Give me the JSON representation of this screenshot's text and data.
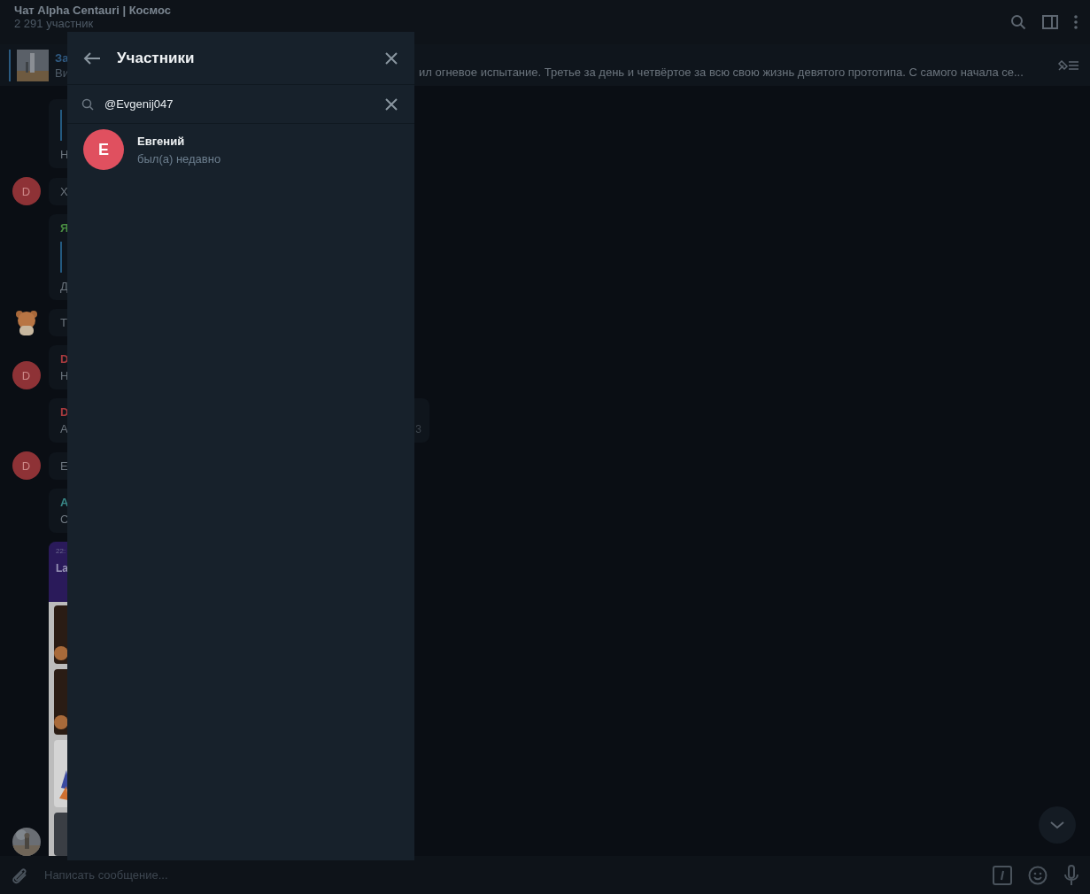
{
  "header": {
    "title": "Чат Alpha Centauri | Космос",
    "subtitle": "2 291 участник"
  },
  "pinned": {
    "title": "За",
    "sender": "Ви",
    "text": "ил огневое испытание. Третье за день и четвёртое за всю свою жизнь девятого прототипа. С самого начала се..."
  },
  "messages": [
    {
      "kind": "text",
      "quote": true,
      "text": "Н"
    },
    {
      "kind": "text",
      "quote": false,
      "text": "Х",
      "avatar": {
        "kind": "letter",
        "letter": "D"
      }
    },
    {
      "kind": "text",
      "name": {
        "text": "Я",
        "color": "#4a8f43"
      },
      "quote": true,
      "text": "Д"
    },
    {
      "kind": "text",
      "quote": false,
      "text": "Т",
      "avatar": {
        "kind": "sticker"
      }
    },
    {
      "kind": "text",
      "name": {
        "text": "D",
        "color": "#a83a3e"
      },
      "quote": false,
      "text": "Н",
      "avatar": {
        "kind": "letter",
        "letter": "D"
      }
    },
    {
      "kind": "text",
      "name": {
        "text": "D",
        "color": "#a83a3e"
      },
      "quote": false,
      "text": "А",
      "time": "3"
    },
    {
      "kind": "text",
      "quote": false,
      "text": "Е",
      "avatar": {
        "kind": "letter",
        "letter": "D"
      }
    },
    {
      "kind": "text",
      "name": {
        "text": "А",
        "color": "#3a8a8a"
      },
      "quote": false,
      "text": "С"
    },
    {
      "image_time": "22:",
      "image_title": "La"
    }
  ],
  "composer": {
    "placeholder": "Написать сообщение..."
  },
  "dialog": {
    "title": "Участники",
    "search_value": "@Evgenij047",
    "members": [
      {
        "initial": "Е",
        "name": "Евгений",
        "status": "был(а) недавно",
        "color": "#e0505f"
      }
    ]
  }
}
